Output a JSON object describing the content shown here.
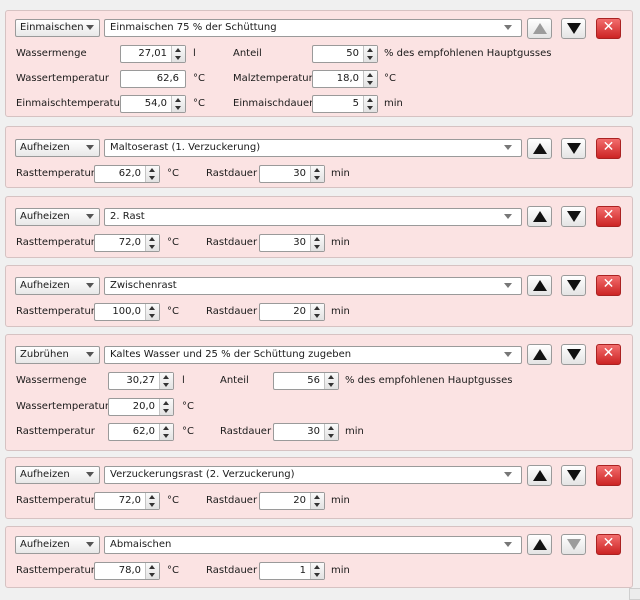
{
  "steps": [
    {
      "type": "Einmaischen",
      "description": "Einmaischen 75 % der Schüttung",
      "fields": {
        "wassermenge_label": "Wassermenge",
        "wassermenge": "27,01",
        "wassermenge_unit": "l",
        "anteil_label": "Anteil",
        "anteil": "50",
        "anteil_unit": "% des empfohlenen Hauptgusses",
        "wassertemp_label": "Wassertemperatur",
        "wassertemp": "62,6",
        "wassertemp_unit": "°C",
        "malztemp_label": "Malztemperatur",
        "malztemp": "18,0",
        "malztemp_unit": "°C",
        "einmaischtemp_label": "Einmaischtemperatur",
        "einmaischtemp": "54,0",
        "einmaischtemp_unit": "°C",
        "einmaischdauer_label": "Einmaischdauer",
        "einmaischdauer": "5",
        "einmaischdauer_unit": "min"
      }
    },
    {
      "type": "Aufheizen",
      "description": "Maltoserast (1. Verzuckerung)",
      "fields": {
        "rasttemp_label": "Rasttemperatur",
        "rasttemp": "62,0",
        "rasttemp_unit": "°C",
        "rastdauer_label": "Rastdauer",
        "rastdauer": "30",
        "rastdauer_unit": "min"
      }
    },
    {
      "type": "Aufheizen",
      "description": "2. Rast",
      "fields": {
        "rasttemp_label": "Rasttemperatur",
        "rasttemp": "72,0",
        "rasttemp_unit": "°C",
        "rastdauer_label": "Rastdauer",
        "rastdauer": "30",
        "rastdauer_unit": "min"
      }
    },
    {
      "type": "Aufheizen",
      "description": "Zwischenrast",
      "fields": {
        "rasttemp_label": "Rasttemperatur",
        "rasttemp": "100,0",
        "rasttemp_unit": "°C",
        "rastdauer_label": "Rastdauer",
        "rastdauer": "20",
        "rastdauer_unit": "min"
      }
    },
    {
      "type": "Zubrühen",
      "description": "Kaltes Wasser und 25 % der Schüttung zugeben",
      "fields": {
        "wassermenge_label": "Wassermenge",
        "wassermenge": "30,27",
        "wassermenge_unit": "l",
        "anteil_label": "Anteil",
        "anteil": "56",
        "anteil_unit": "% des empfohlenen Hauptgusses",
        "wassertemp_label": "Wassertemperatur",
        "wassertemp": "20,0",
        "wassertemp_unit": "°C",
        "rasttemp_label": "Rasttemperatur",
        "rasttemp": "62,0",
        "rasttemp_unit": "°C",
        "rastdauer_label": "Rastdauer",
        "rastdauer": "30",
        "rastdauer_unit": "min"
      }
    },
    {
      "type": "Aufheizen",
      "description": "Verzuckerungsrast (2. Verzuckerung)",
      "fields": {
        "rasttemp_label": "Rasttemperatur",
        "rasttemp": "72,0",
        "rasttemp_unit": "°C",
        "rastdauer_label": "Rastdauer",
        "rastdauer": "20",
        "rastdauer_unit": "min"
      }
    },
    {
      "type": "Aufheizen",
      "description": "Abmaischen",
      "fields": {
        "rasttemp_label": "Rasttemperatur",
        "rasttemp": "78,0",
        "rasttemp_unit": "°C",
        "rastdauer_label": "Rastdauer",
        "rastdauer": "1",
        "rastdauer_unit": "min"
      }
    }
  ],
  "buttons": {
    "delete_glyph": "✕"
  },
  "colors": {
    "step_background": "#fbe3e3",
    "delete_button": "#d93030",
    "window_background": "#f0f0f0"
  }
}
